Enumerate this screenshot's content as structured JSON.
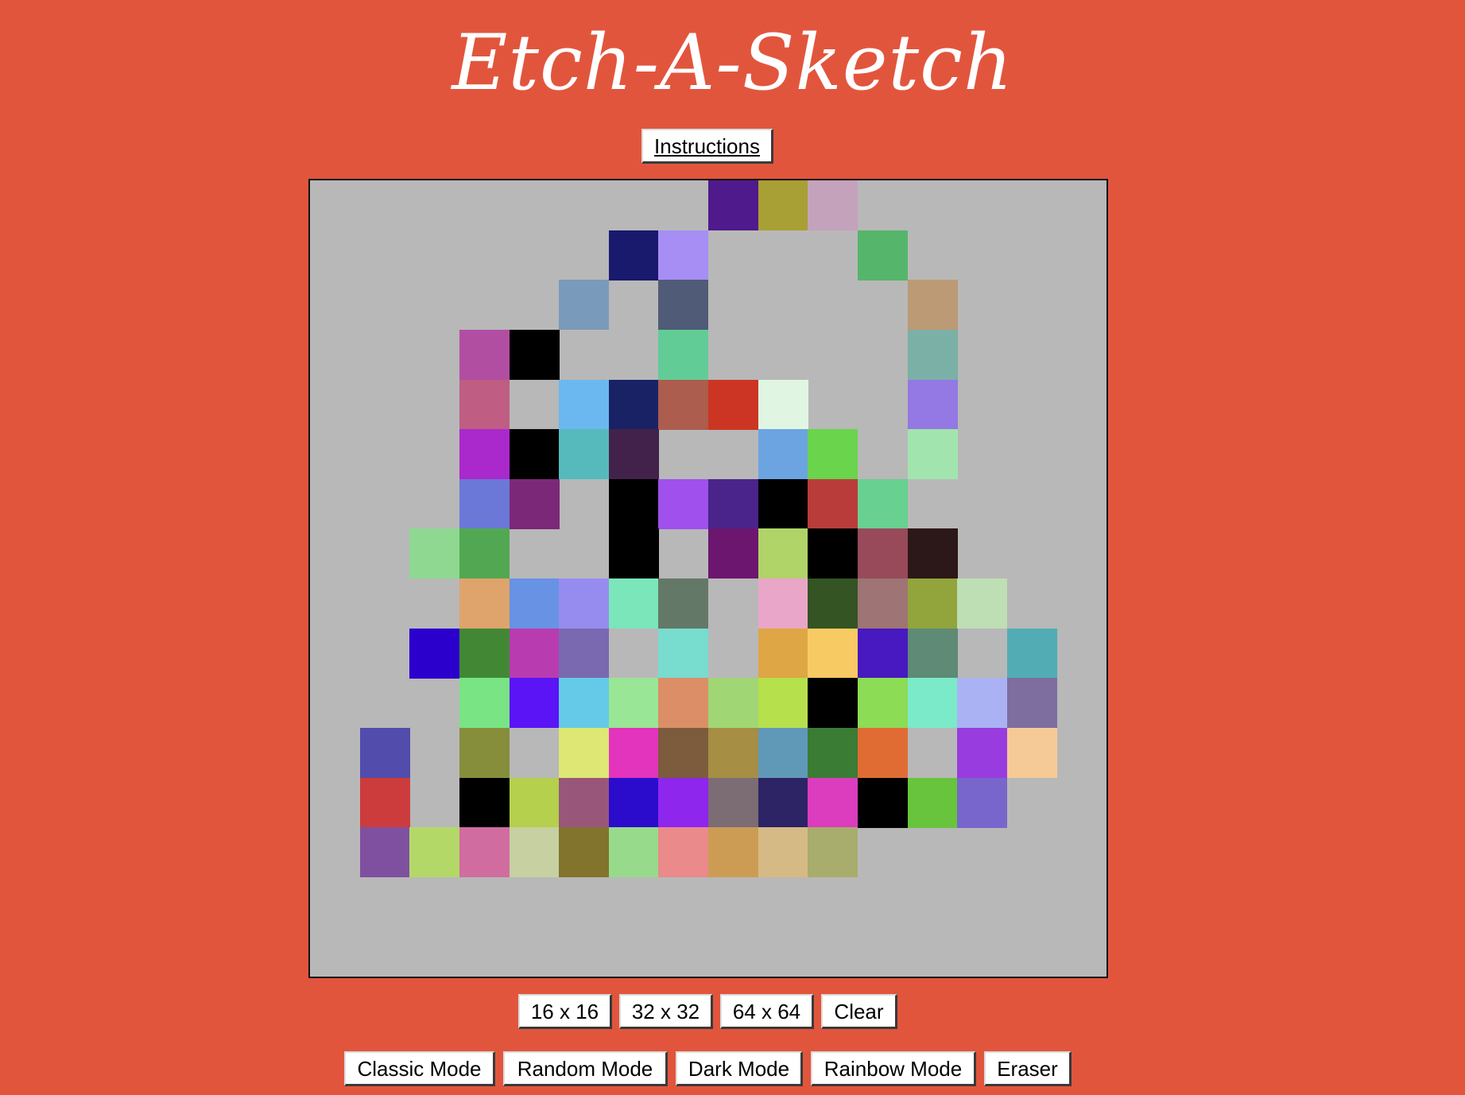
{
  "app": {
    "title": "Etch-A-Sketch",
    "instructions_label": "Instructions"
  },
  "colors": {
    "background": "#e2553d",
    "grid_background": "#b8b8b8"
  },
  "grid": {
    "size": 16,
    "painted_cells": [
      {
        "r": 0,
        "c": 8,
        "color": "#4f1a8c"
      },
      {
        "r": 0,
        "c": 9,
        "color": "#a8a034"
      },
      {
        "r": 0,
        "c": 10,
        "color": "#c4a2bc"
      },
      {
        "r": 1,
        "c": 6,
        "color": "#19196e"
      },
      {
        "r": 1,
        "c": 7,
        "color": "#a68ef4"
      },
      {
        "r": 1,
        "c": 11,
        "color": "#55b66b"
      },
      {
        "r": 2,
        "c": 5,
        "color": "#7a9abb"
      },
      {
        "r": 2,
        "c": 7,
        "color": "#505b78"
      },
      {
        "r": 2,
        "c": 12,
        "color": "#bc9a76"
      },
      {
        "r": 3,
        "c": 3,
        "color": "#b24ea2"
      },
      {
        "r": 3,
        "c": 4,
        "color": "#000000"
      },
      {
        "r": 3,
        "c": 7,
        "color": "#62cc96"
      },
      {
        "r": 3,
        "c": 12,
        "color": "#7bb0a6"
      },
      {
        "r": 4,
        "c": 3,
        "color": "#c05d82"
      },
      {
        "r": 4,
        "c": 5,
        "color": "#6bb8f0"
      },
      {
        "r": 4,
        "c": 6,
        "color": "#1a2266"
      },
      {
        "r": 4,
        "c": 7,
        "color": "#ac5d4d"
      },
      {
        "r": 4,
        "c": 8,
        "color": "#cc3524"
      },
      {
        "r": 4,
        "c": 9,
        "color": "#e0f6e2"
      },
      {
        "r": 4,
        "c": 12,
        "color": "#9478e4"
      },
      {
        "r": 5,
        "c": 3,
        "color": "#a929cc"
      },
      {
        "r": 5,
        "c": 4,
        "color": "#000000"
      },
      {
        "r": 5,
        "c": 5,
        "color": "#56babc"
      },
      {
        "r": 5,
        "c": 6,
        "color": "#42224a"
      },
      {
        "r": 5,
        "c": 9,
        "color": "#6ca4e2"
      },
      {
        "r": 5,
        "c": 10,
        "color": "#6ad44c"
      },
      {
        "r": 5,
        "c": 12,
        "color": "#a2e4ae"
      },
      {
        "r": 6,
        "c": 3,
        "color": "#6c78d8"
      },
      {
        "r": 6,
        "c": 4,
        "color": "#7c2878"
      },
      {
        "r": 6,
        "c": 6,
        "color": "#000000"
      },
      {
        "r": 6,
        "c": 7,
        "color": "#a050ec"
      },
      {
        "r": 6,
        "c": 8,
        "color": "#4a248a"
      },
      {
        "r": 6,
        "c": 9,
        "color": "#000000"
      },
      {
        "r": 6,
        "c": 10,
        "color": "#ba3c3a"
      },
      {
        "r": 6,
        "c": 11,
        "color": "#68d090"
      },
      {
        "r": 7,
        "c": 2,
        "color": "#8ed892"
      },
      {
        "r": 7,
        "c": 3,
        "color": "#52a852"
      },
      {
        "r": 7,
        "c": 6,
        "color": "#000000"
      },
      {
        "r": 7,
        "c": 8,
        "color": "#6c1670"
      },
      {
        "r": 7,
        "c": 9,
        "color": "#b0d468"
      },
      {
        "r": 7,
        "c": 10,
        "color": "#000000"
      },
      {
        "r": 7,
        "c": 11,
        "color": "#984a5a"
      },
      {
        "r": 7,
        "c": 12,
        "color": "#2c1818"
      },
      {
        "r": 8,
        "c": 3,
        "color": "#dea46c"
      },
      {
        "r": 8,
        "c": 4,
        "color": "#6892e4"
      },
      {
        "r": 8,
        "c": 5,
        "color": "#968cf0"
      },
      {
        "r": 8,
        "c": 6,
        "color": "#7ae6ba"
      },
      {
        "r": 8,
        "c": 7,
        "color": "#647868"
      },
      {
        "r": 8,
        "c": 9,
        "color": "#eaa6c8"
      },
      {
        "r": 8,
        "c": 10,
        "color": "#345424"
      },
      {
        "r": 8,
        "c": 11,
        "color": "#9e7474"
      },
      {
        "r": 8,
        "c": 12,
        "color": "#92a43c"
      },
      {
        "r": 8,
        "c": 13,
        "color": "#bedeb4"
      },
      {
        "r": 9,
        "c": 2,
        "color": "#2c00cc"
      },
      {
        "r": 9,
        "c": 3,
        "color": "#428834"
      },
      {
        "r": 9,
        "c": 4,
        "color": "#b83cb0"
      },
      {
        "r": 9,
        "c": 5,
        "color": "#7a68b0"
      },
      {
        "r": 9,
        "c": 7,
        "color": "#78dcce"
      },
      {
        "r": 9,
        "c": 9,
        "color": "#dea644"
      },
      {
        "r": 9,
        "c": 10,
        "color": "#f8ca64"
      },
      {
        "r": 9,
        "c": 11,
        "color": "#4818c0"
      },
      {
        "r": 9,
        "c": 12,
        "color": "#5e8a76"
      },
      {
        "r": 9,
        "c": 14,
        "color": "#52acb4"
      },
      {
        "r": 10,
        "c": 3,
        "color": "#78e484"
      },
      {
        "r": 10,
        "c": 4,
        "color": "#5a14f6"
      },
      {
        "r": 10,
        "c": 5,
        "color": "#64cae8"
      },
      {
        "r": 10,
        "c": 6,
        "color": "#98e696"
      },
      {
        "r": 10,
        "c": 7,
        "color": "#dc8e66"
      },
      {
        "r": 10,
        "c": 8,
        "color": "#a0d674"
      },
      {
        "r": 10,
        "c": 9,
        "color": "#b6e04c"
      },
      {
        "r": 10,
        "c": 10,
        "color": "#000000"
      },
      {
        "r": 10,
        "c": 11,
        "color": "#8cdc56"
      },
      {
        "r": 10,
        "c": 12,
        "color": "#7aeac8"
      },
      {
        "r": 10,
        "c": 13,
        "color": "#aab2f4"
      },
      {
        "r": 10,
        "c": 14,
        "color": "#7e6ea0"
      },
      {
        "r": 11,
        "c": 1,
        "color": "#524cac"
      },
      {
        "r": 11,
        "c": 3,
        "color": "#868e3c"
      },
      {
        "r": 11,
        "c": 5,
        "color": "#dee674"
      },
      {
        "r": 11,
        "c": 6,
        "color": "#e234bc"
      },
      {
        "r": 11,
        "c": 7,
        "color": "#7c5c3c"
      },
      {
        "r": 11,
        "c": 8,
        "color": "#a68e44"
      },
      {
        "r": 11,
        "c": 9,
        "color": "#6098b8"
      },
      {
        "r": 11,
        "c": 10,
        "color": "#3a7c34"
      },
      {
        "r": 11,
        "c": 11,
        "color": "#e06c34"
      },
      {
        "r": 11,
        "c": 13,
        "color": "#983ce0"
      },
      {
        "r": 11,
        "c": 14,
        "color": "#f6ca96"
      },
      {
        "r": 12,
        "c": 1,
        "color": "#cc3c3c"
      },
      {
        "r": 12,
        "c": 3,
        "color": "#000000"
      },
      {
        "r": 12,
        "c": 4,
        "color": "#b4d04c"
      },
      {
        "r": 12,
        "c": 5,
        "color": "#98567a"
      },
      {
        "r": 12,
        "c": 6,
        "color": "#2c0ccc"
      },
      {
        "r": 12,
        "c": 7,
        "color": "#8e26ee"
      },
      {
        "r": 12,
        "c": 8,
        "color": "#7c6c74"
      },
      {
        "r": 12,
        "c": 9,
        "color": "#2c2464"
      },
      {
        "r": 12,
        "c": 10,
        "color": "#dc3cbe"
      },
      {
        "r": 12,
        "c": 11,
        "color": "#000000"
      },
      {
        "r": 12,
        "c": 12,
        "color": "#68c43c"
      },
      {
        "r": 12,
        "c": 13,
        "color": "#7866cc"
      },
      {
        "r": 13,
        "c": 1,
        "color": "#8050a0"
      },
      {
        "r": 13,
        "c": 2,
        "color": "#b4d868"
      },
      {
        "r": 13,
        "c": 3,
        "color": "#d06ca0"
      },
      {
        "r": 13,
        "c": 4,
        "color": "#c6d0a0"
      },
      {
        "r": 13,
        "c": 5,
        "color": "#82742c"
      },
      {
        "r": 13,
        "c": 6,
        "color": "#98da8c"
      },
      {
        "r": 13,
        "c": 7,
        "color": "#ea8a8a"
      },
      {
        "r": 13,
        "c": 8,
        "color": "#cc9c54"
      },
      {
        "r": 13,
        "c": 9,
        "color": "#d6ba86"
      },
      {
        "r": 13,
        "c": 10,
        "color": "#a8ac6c"
      }
    ]
  },
  "size_buttons": [
    "16 x 16",
    "32 x 32",
    "64 x 64",
    "Clear"
  ],
  "mode_buttons": [
    "Classic Mode",
    "Random Mode",
    "Dark Mode",
    "Rainbow Mode",
    "Eraser"
  ]
}
